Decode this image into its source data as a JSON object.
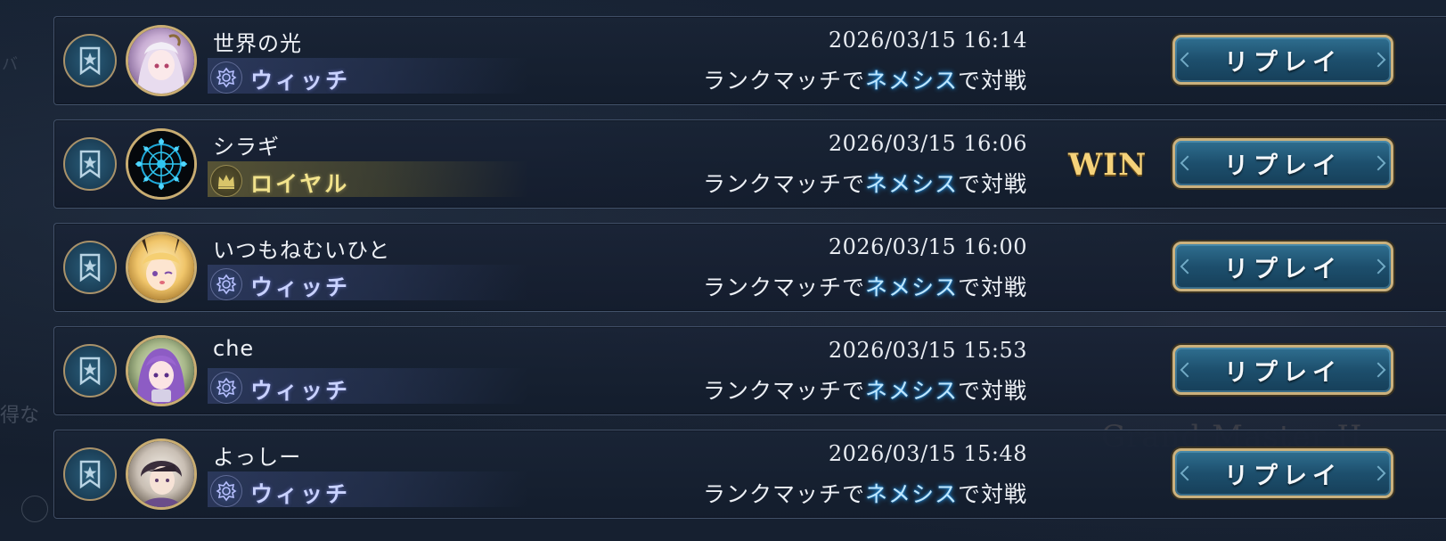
{
  "background": {
    "fragment_1": "バ",
    "fragment_2": "得な",
    "fragment_3": "Grand Master II"
  },
  "entries": [
    {
      "name": "世界の光",
      "class": "ウィッチ",
      "class_type": "witch",
      "timestamp": "2026/03/15 16:14",
      "match_prefix": "ランクマッチで",
      "match_format": "ネメシス",
      "match_suffix": "で対戦",
      "result": "",
      "replay_label": "リプレイ"
    },
    {
      "name": "シラギ",
      "class": "ロイヤル",
      "class_type": "royal",
      "timestamp": "2026/03/15 16:06",
      "match_prefix": "ランクマッチで",
      "match_format": "ネメシス",
      "match_suffix": "で対戦",
      "result": "WIN",
      "replay_label": "リプレイ"
    },
    {
      "name": "いつもねむいひと",
      "class": "ウィッチ",
      "class_type": "witch",
      "timestamp": "2026/03/15 16:00",
      "match_prefix": "ランクマッチで",
      "match_format": "ネメシス",
      "match_suffix": "で対戦",
      "result": "",
      "replay_label": "リプレイ"
    },
    {
      "name": "che",
      "class": "ウィッチ",
      "class_type": "witch",
      "timestamp": "2026/03/15 15:53",
      "match_prefix": "ランクマッチで",
      "match_format": "ネメシス",
      "match_suffix": "で対戦",
      "result": "",
      "replay_label": "リプレイ"
    },
    {
      "name": "よっしー",
      "class": "ウィッチ",
      "class_type": "witch",
      "timestamp": "2026/03/15 15:48",
      "match_prefix": "ランクマッチで",
      "match_format": "ネメシス",
      "match_suffix": "で対戦",
      "result": "",
      "replay_label": "リプレイ"
    }
  ],
  "colors": {
    "witch_text": "#c9d2ff",
    "royal_text": "#f2e38c",
    "highlight": "#bfe7ff",
    "win": "#f5d27a",
    "button_border": "#cbb17d"
  },
  "icons": {
    "bookmark": "bookmark-star-icon",
    "witch": "witch-crest-icon",
    "royal": "royal-crown-icon"
  }
}
